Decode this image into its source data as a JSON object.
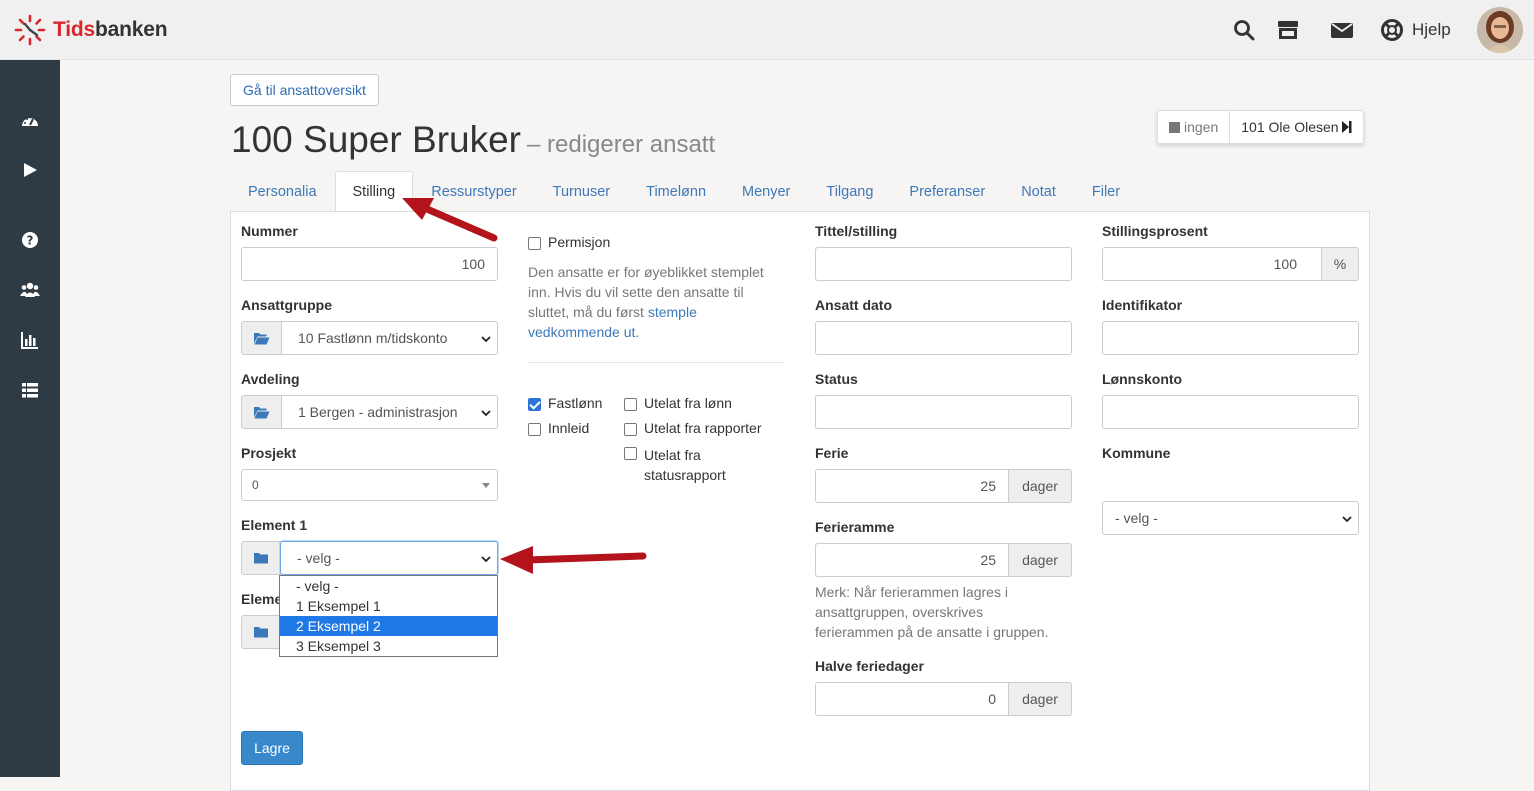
{
  "app": {
    "logo_text_1": "Tids",
    "logo_text_2": "banken",
    "help_label": "Hjelp"
  },
  "colors": {
    "accent": "#3d79b8",
    "brand_red": "#d9262c",
    "sidebar": "#2e3a44",
    "primary_button": "#3a88cc",
    "highlight": "#1e78e6",
    "annotation_arrow": "#b3141b"
  },
  "header_icons": [
    "search-icon",
    "store-icon",
    "envelope-icon",
    "lifebuoy-icon"
  ],
  "sidebar_icons": [
    "dashboard-icon",
    "play-icon",
    "question-icon",
    "users-icon",
    "bar-chart-icon",
    "list-icon"
  ],
  "back_button": "Gå til ansattoversikt",
  "title": {
    "main": "100 Super Bruker",
    "sub": "– redigerer ansatt"
  },
  "switcher": {
    "left": "ingen",
    "right": "101 Ole Olesen"
  },
  "tabs": [
    "Personalia",
    "Stilling",
    "Ressurstyper",
    "Turnuser",
    "Timelønn",
    "Menyer",
    "Tilgang",
    "Preferanser",
    "Notat",
    "Filer"
  ],
  "active_tab": "Stilling",
  "col1": {
    "nummer_label": "Nummer",
    "nummer_value": "100",
    "ansattgruppe_label": "Ansattgruppe",
    "ansattgruppe_value": "10 Fastlønn m/tidskonto",
    "avdeling_label": "Avdeling",
    "avdeling_value": "1 Bergen - administrasjon",
    "prosjekt_label": "Prosjekt",
    "prosjekt_value": "0",
    "element1_label": "Element 1",
    "element1_value": "- velg -",
    "element2_label": "Eleme"
  },
  "dropdown": {
    "options": [
      "- velg -",
      "1 Eksempel 1",
      "2 Eksempel 2",
      "3 Eksempel 3"
    ],
    "highlighted": "2 Eksempel 2"
  },
  "col2": {
    "permisjon_label": "Permisjon",
    "note_1": "Den ansatte er for øyeblikket stemplet",
    "note_2": "inn. Hvis du vil sette den ansatte til",
    "note_3": "sluttet, må du først",
    "note_link_1": "stemple",
    "note_link_2": "vedkommende ut",
    "note_end": ".",
    "fastlonn": "Fastlønn",
    "fastlonn_checked": true,
    "innleid": "Innleid",
    "innleid_checked": false,
    "utelat_lonn": "Utelat fra lønn",
    "utelat_rapporter": "Utelat fra rapporter",
    "utelat_status_1": "Utelat fra",
    "utelat_status_2": "statusrapport"
  },
  "col3": {
    "tittel_label": "Tittel/stilling",
    "tittel_value": "",
    "ansatt_dato_label": "Ansatt dato",
    "ansatt_dato_value": "",
    "status_label": "Status",
    "status_value": "",
    "ferie_label": "Ferie",
    "ferie_value": "25",
    "ferie_unit": "dager",
    "ferieramme_label": "Ferieramme",
    "ferieramme_value": "25",
    "ferieramme_unit": "dager",
    "merk_1": "Merk: Når ferierammen lagres i",
    "merk_2": "ansattgruppen, overskrives",
    "merk_3": "ferierammen på de ansatte i gruppen.",
    "halve_label": "Halve feriedager",
    "halve_value": "0",
    "halve_unit": "dager"
  },
  "col4": {
    "stillingsprosent_label": "Stillingsprosent",
    "stillingsprosent_value": "100",
    "stillingsprosent_unit": "%",
    "identifikator_label": "Identifikator",
    "identifikator_value": "",
    "lonnskonto_label": "Lønnskonto",
    "lonnskonto_value": "",
    "kommune_label": "Kommune",
    "kommune_value": "- velg -"
  },
  "save_button": "Lagre"
}
